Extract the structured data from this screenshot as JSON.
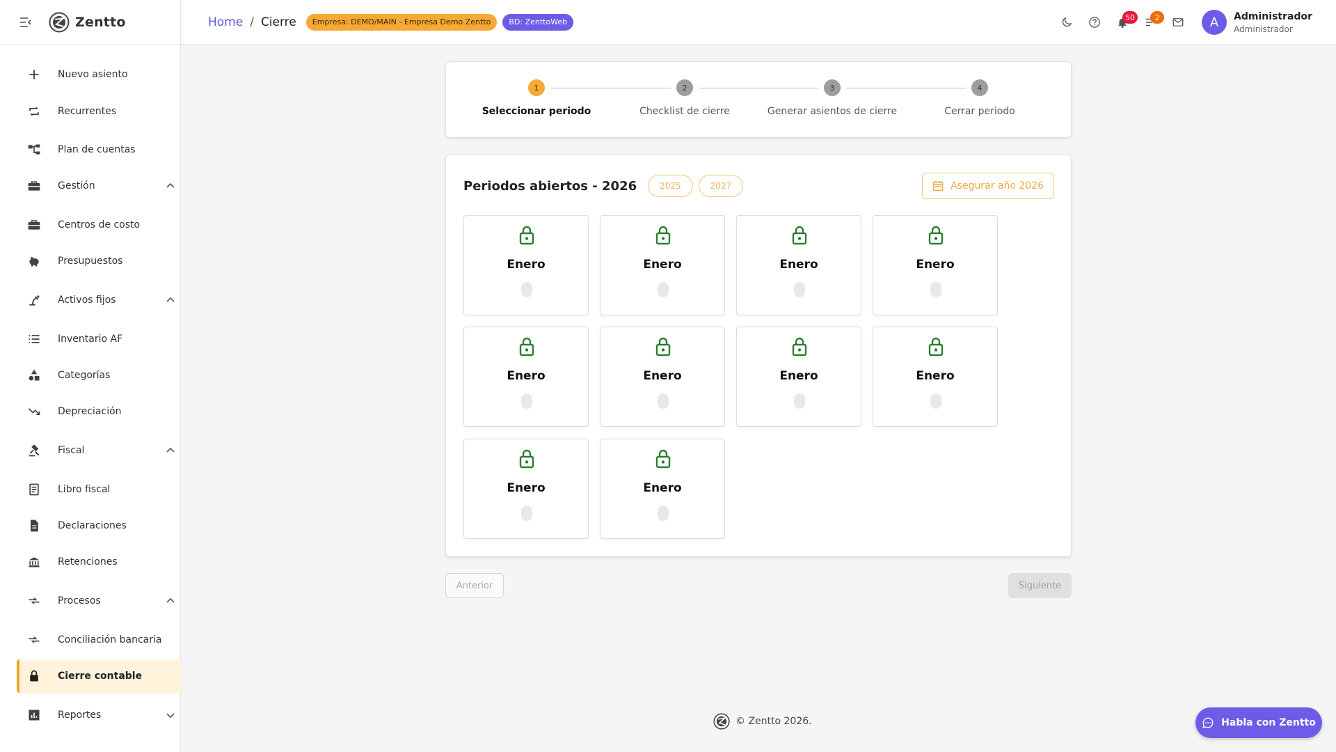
{
  "brand": {
    "name": "Zentto"
  },
  "sidebar": {
    "items": [
      {
        "label": "Nuevo asiento",
        "icon": "plus-icon"
      },
      {
        "label": "Recurrentes",
        "icon": "repeat-icon"
      },
      {
        "label": "Plan de cuentas",
        "icon": "account-tree-icon"
      },
      {
        "label": "Gestión",
        "icon": "briefcase-icon",
        "expanded": true
      },
      {
        "label": "Centros de costo",
        "icon": "briefcase-icon"
      },
      {
        "label": "Presupuestos",
        "icon": "piggy-bank-icon"
      },
      {
        "label": "Activos fijos",
        "icon": "precision-tool-icon",
        "expanded": true
      },
      {
        "label": "Inventario AF",
        "icon": "list-icon"
      },
      {
        "label": "Categorías",
        "icon": "category-shapes-icon"
      },
      {
        "label": "Depreciación",
        "icon": "trending-down-icon"
      },
      {
        "label": "Fiscal",
        "icon": "gavel-icon",
        "expanded": true
      },
      {
        "label": "Libro fiscal",
        "icon": "receipt-book-icon"
      },
      {
        "label": "Declaraciones",
        "icon": "document-icon"
      },
      {
        "label": "Retenciones",
        "icon": "bank-icon"
      },
      {
        "label": "Procesos",
        "icon": "compare-arrows-icon",
        "expanded": true
      },
      {
        "label": "Conciliación bancaria",
        "icon": "compare-arrows-icon"
      },
      {
        "label": "Cierre contable",
        "icon": "lock-icon",
        "active": true
      },
      {
        "label": "Reportes",
        "icon": "bar-chart-icon",
        "expanded": false
      }
    ]
  },
  "topbar": {
    "breadcrumb": {
      "home": "Home",
      "separator": "/",
      "current": "Cierre"
    },
    "empresa_chip": "Empresa: DEMO/MAIN - Empresa Demo Zentto",
    "bd_chip": "BD: ZenttoWeb",
    "notifications_count": "50",
    "tasks_count": "2",
    "user": {
      "initial": "A",
      "name": "Administrador",
      "role": "Administrador"
    }
  },
  "stepper": {
    "steps": [
      {
        "number": "1",
        "label": "Seleccionar periodo",
        "active": true
      },
      {
        "number": "2",
        "label": "Checklist de cierre",
        "active": false
      },
      {
        "number": "3",
        "label": "Generar asientos de cierre",
        "active": false
      },
      {
        "number": "4",
        "label": "Cerrar periodo",
        "active": false
      }
    ]
  },
  "periods": {
    "title": "Periodos abiertos - 2026",
    "year_buttons": [
      "2025",
      "2027"
    ],
    "secure_button": "Asegurar año 2026",
    "months": [
      "Enero",
      "Enero",
      "Enero",
      "Enero",
      "Enero",
      "Enero",
      "Enero",
      "Enero",
      "Enero",
      "Enero"
    ]
  },
  "navigation": {
    "prev": "Anterior",
    "next": "Siguiente"
  },
  "footer": {
    "text": "© Zentto 2026."
  },
  "chat": {
    "label": "Habla con Zentto"
  },
  "colors": {
    "accent": "#f7a935",
    "primary": "#6c5ce7",
    "lock": "#2e7d32",
    "home_link": "#5b5bd6"
  }
}
